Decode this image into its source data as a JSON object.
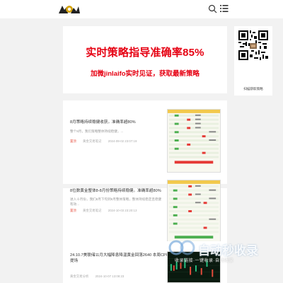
{
  "header": {
    "logo_icon": "logo-icon",
    "search_icon": "search-icon",
    "menu_icon": "menu-icon"
  },
  "banner": {
    "title": "实时策略指导准确率85%",
    "subtitle": "加微jinlaifo实时见证，获取最新策略",
    "accent_color": "#e60012"
  },
  "qr": {
    "caption": "扫描获取策略"
  },
  "articles": [
    {
      "title": "8月策略持续稳健收获。准确率超80%",
      "excerpt": "整个8月，我们策略整体持续稳健，...",
      "tag": "置顶",
      "category": "黄金交易笔记",
      "date": "2024-09-02 23:07:19"
    },
    {
      "title": "8位数黄金整体8-8月份策略持续稳健。准确率超80%",
      "excerpt": "进入十月份，我们8月下旬到9月整体策略，整体持续稳定且稳健有效...",
      "tag": "置顶",
      "category": "黄金交易笔记",
      "date": "2024-10-03 23:20:13"
    },
    {
      "title": "24.10.7美联储11月大幅降息降温黄金回落2640 本周CPI提场",
      "excerpt": "",
      "tag": "",
      "category": "黄金交易分析",
      "date": "2024-10-07 13:08:23"
    }
  ],
  "watermark": {
    "title": "自动秒收录",
    "subtitle": "收录链接·一键收录·自动收录"
  }
}
